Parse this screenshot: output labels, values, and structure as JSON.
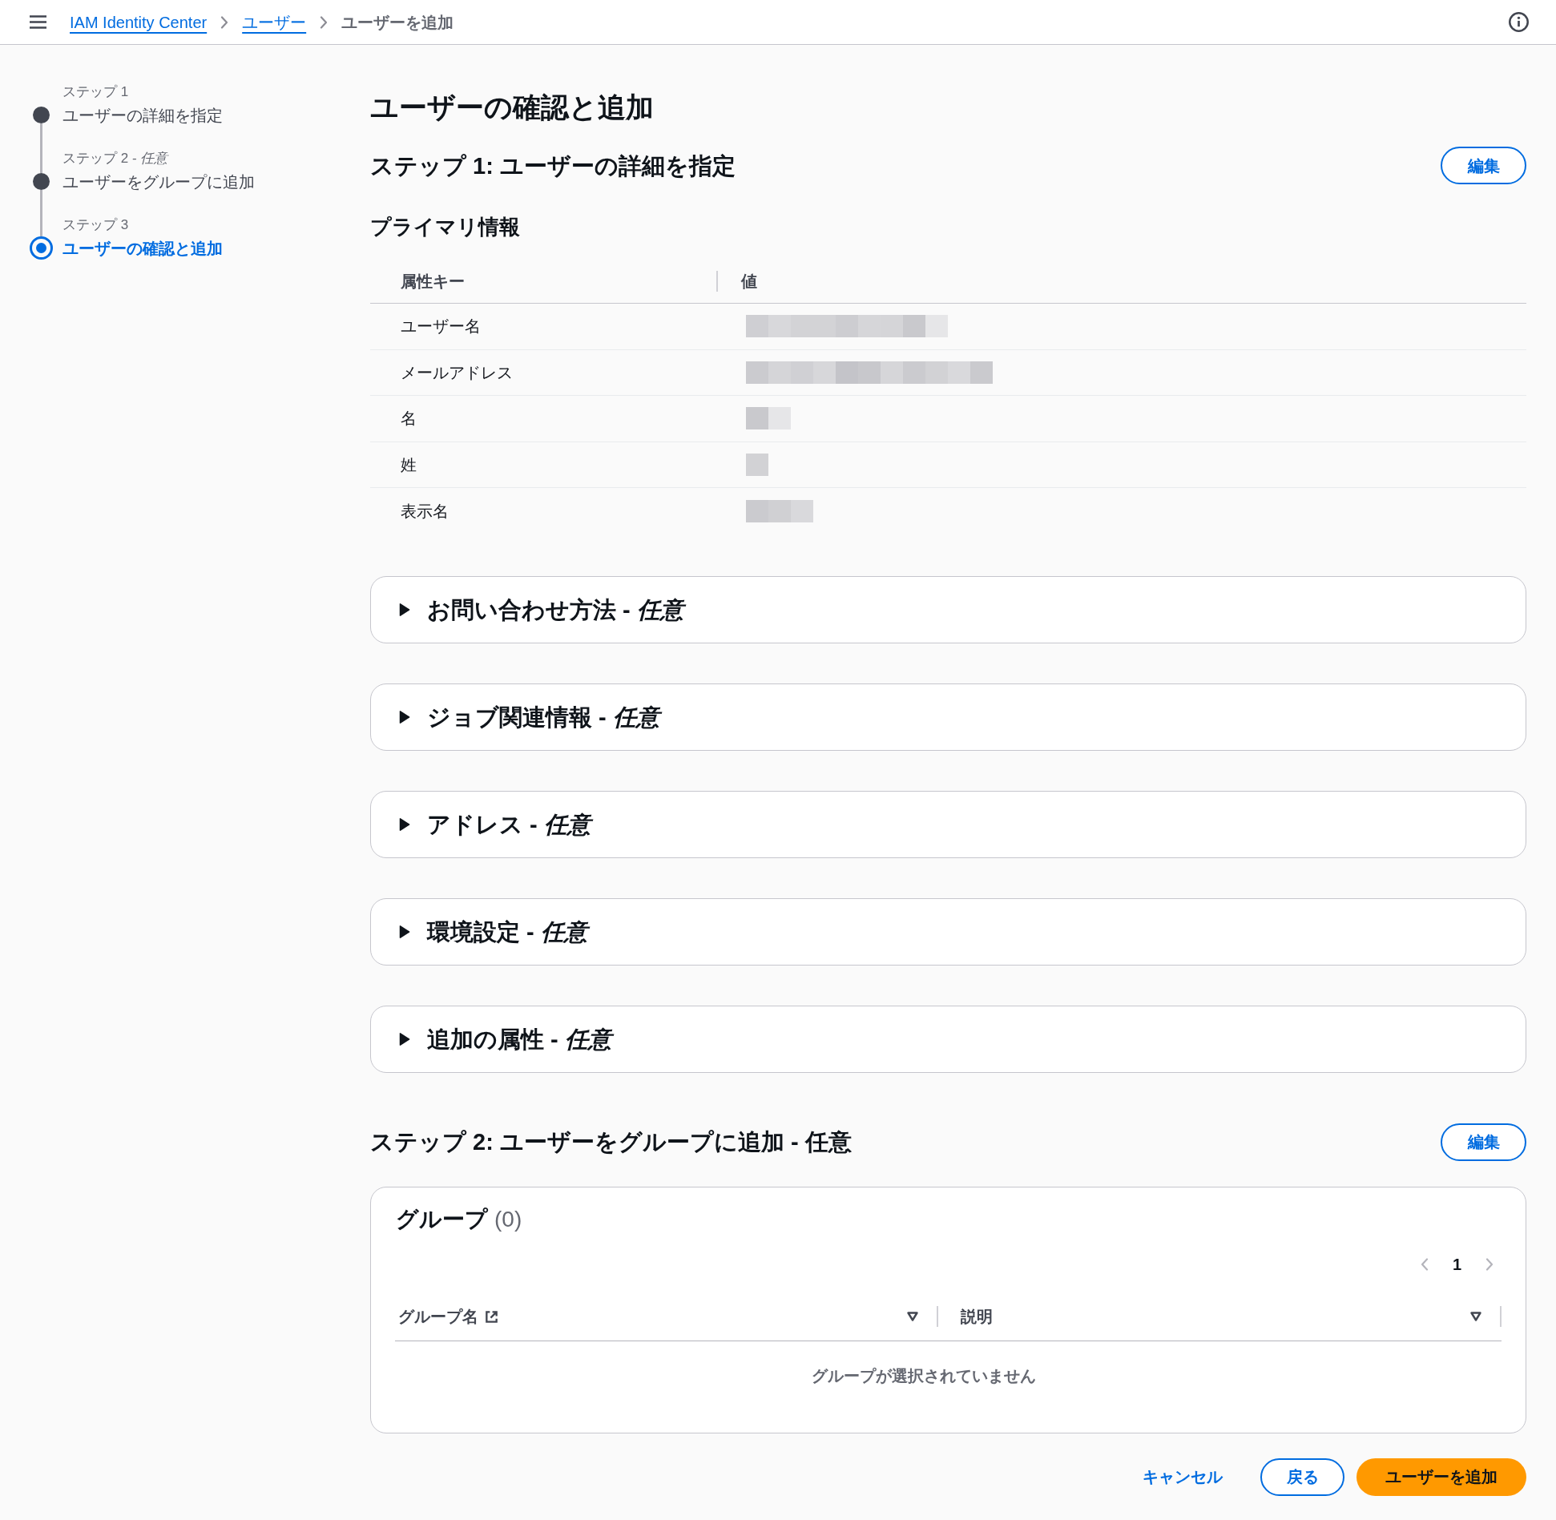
{
  "header": {
    "breadcrumbs": [
      {
        "label": "IAM Identity Center",
        "kind": "link"
      },
      {
        "label": "ユーザー",
        "kind": "link"
      },
      {
        "label": "ユーザーを追加",
        "kind": "current"
      }
    ]
  },
  "steps": [
    {
      "label": "ステップ 1",
      "title": "ユーザーの詳細を指定",
      "selected": false
    },
    {
      "label": "ステップ 2 - *任意*",
      "title": "ユーザーをグループに追加",
      "selected": false
    },
    {
      "label": "ステップ 3",
      "title": "ユーザーの確認と追加",
      "selected": true
    }
  ],
  "page_title": "ユーザーの確認と追加",
  "step1": {
    "title": "ステップ 1: ユーザーの詳細を指定",
    "edit_button": "編集",
    "primary_info": {
      "title": "プライマリ情報",
      "columns": [
        "属性キー",
        "値"
      ],
      "rows": [
        {
          "key": "ユーザー名",
          "value_redacted": true
        },
        {
          "key": "メールアドレス",
          "value_redacted": true
        },
        {
          "key": "名",
          "value_redacted": true
        },
        {
          "key": "姓",
          "value_redacted": true
        },
        {
          "key": "表示名",
          "value_redacted": true
        }
      ]
    },
    "sections": [
      {
        "title": "お問い合わせ方法 - *任意*",
        "expanded": false
      },
      {
        "title": "ジョブ関連情報 - *任意*",
        "expanded": false
      },
      {
        "title": "アドレス - *任意*",
        "expanded": false
      },
      {
        "title": "環境設定 - *任意*",
        "expanded": false
      },
      {
        "title": "追加の属性 - *任意*",
        "expanded": false
      }
    ]
  },
  "step2": {
    "title": "ステップ 2: ユーザーをグループに追加 - 任意",
    "edit_button": "編集",
    "groups": {
      "title": "グループ",
      "count": "(0)",
      "pagination": {
        "page": "1",
        "prev_disabled": true,
        "next_disabled": true
      },
      "columns": [
        {
          "label": "グループ名",
          "external_link": true
        },
        {
          "label": "説明",
          "external_link": false
        }
      ],
      "empty_text": "グループが選択されていません"
    }
  },
  "footer": {
    "cancel": "キャンセル",
    "back": "戻る",
    "submit": "ユーザーを追加"
  }
}
